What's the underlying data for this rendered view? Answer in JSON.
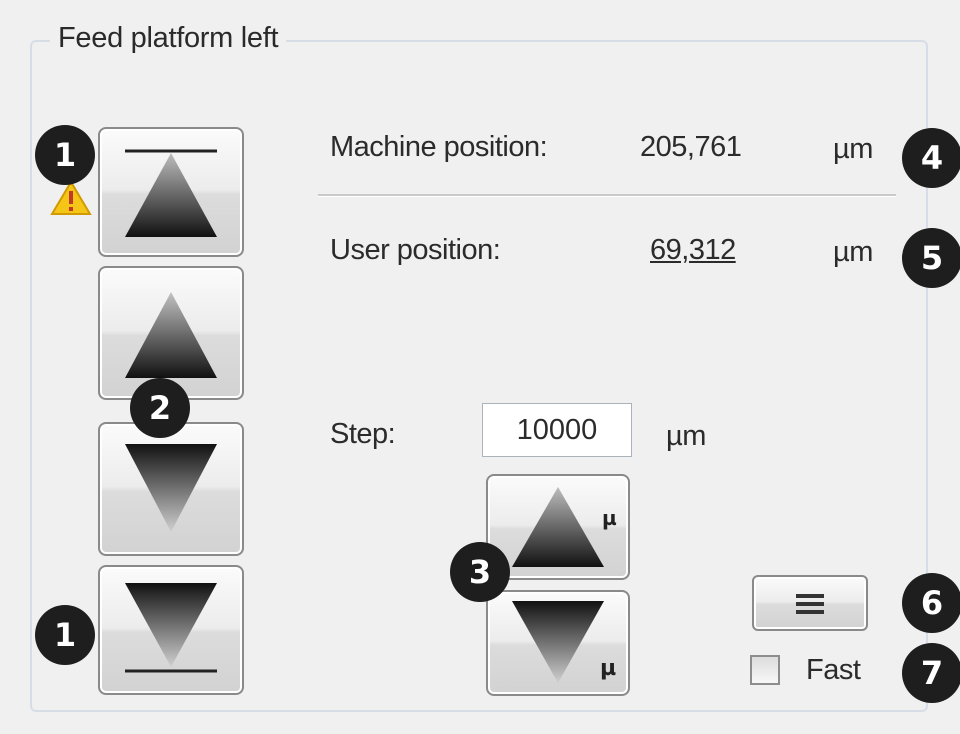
{
  "group": {
    "title": "Feed platform left"
  },
  "machine_position": {
    "label": "Machine position:",
    "value": "205,761",
    "unit": "µm"
  },
  "user_position": {
    "label": "User position:",
    "value": "69,312",
    "unit": "µm"
  },
  "step": {
    "label": "Step:",
    "value": "10000",
    "unit": "µm"
  },
  "fine_buttons": {
    "up_badge": "µ",
    "down_badge": "µ"
  },
  "fast": {
    "label": "Fast",
    "checked": false
  },
  "markers": [
    "1",
    "2",
    "3",
    "4",
    "5",
    "6",
    "7"
  ],
  "icons": {
    "warning": "warning-icon",
    "move_to_top": "arrow-up-to-limit-icon",
    "move_up": "arrow-up-icon",
    "move_down": "arrow-down-icon",
    "move_to_bottom": "arrow-down-to-limit-icon",
    "menu": "menu-icon"
  },
  "colors": {
    "marker": "#1e1e1e",
    "warning": "#f5c518",
    "panel": "#f0f0f0"
  }
}
